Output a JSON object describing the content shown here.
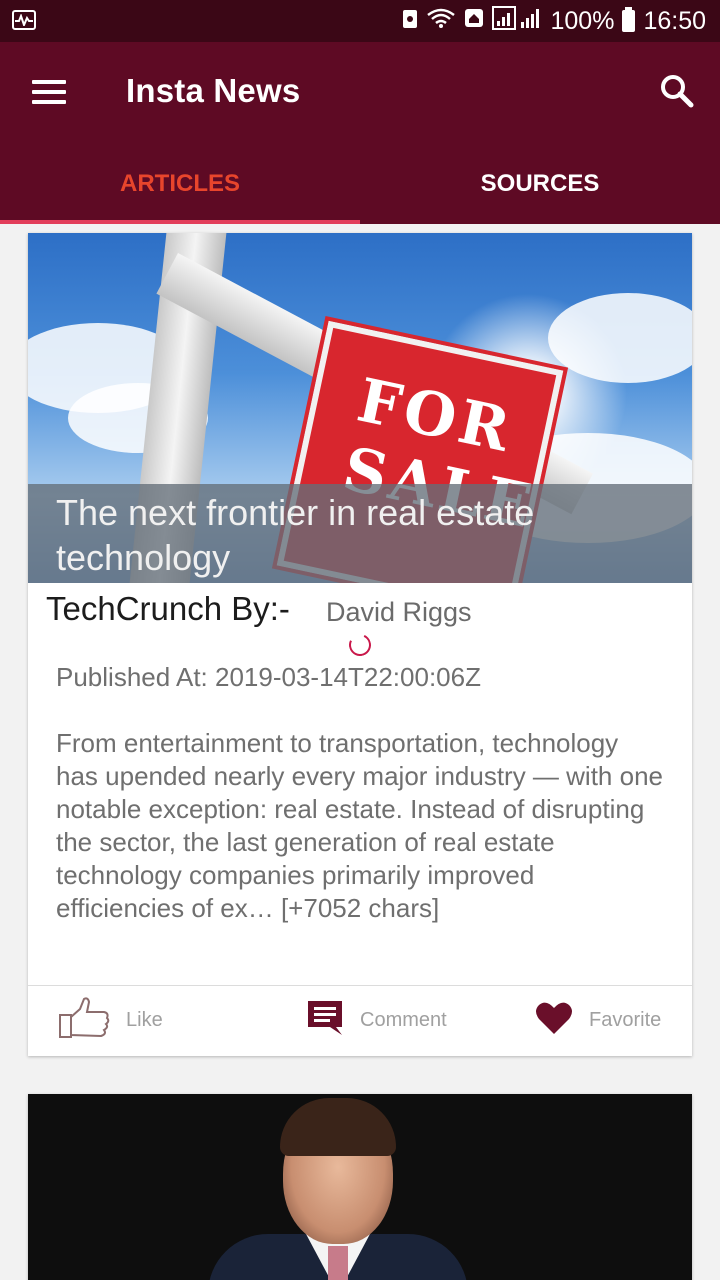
{
  "status_bar": {
    "battery": "100%",
    "time": "16:50"
  },
  "app_bar": {
    "title": "Insta News"
  },
  "tabs": [
    {
      "label": "ARTICLES",
      "selected": true
    },
    {
      "label": "SOURCES",
      "selected": false
    }
  ],
  "articles": [
    {
      "title": "The next frontier in real estate technology",
      "source_line": "TechCrunch By:-",
      "author": "David Riggs",
      "published": "Published At: 2019-03-14T22:00:06Z",
      "description": "From entertainment to transportation, technology has upended nearly every major industry — with one notable exception: real estate. Instead of disrupting the sector, the last generation of real estate technology companies primarily improved efficiencies of ex… [+7052 chars]",
      "image_text": "FOR SALE",
      "actions": {
        "like": "Like",
        "comment": "Comment",
        "favorite": "Favorite"
      }
    }
  ],
  "colors": {
    "status_bar": "#3b0716",
    "app_bar": "#5e0a24",
    "tab_selected": "#e8452c",
    "tab_indicator": "#e23d5a",
    "icon_accent": "#6a0f2a"
  }
}
